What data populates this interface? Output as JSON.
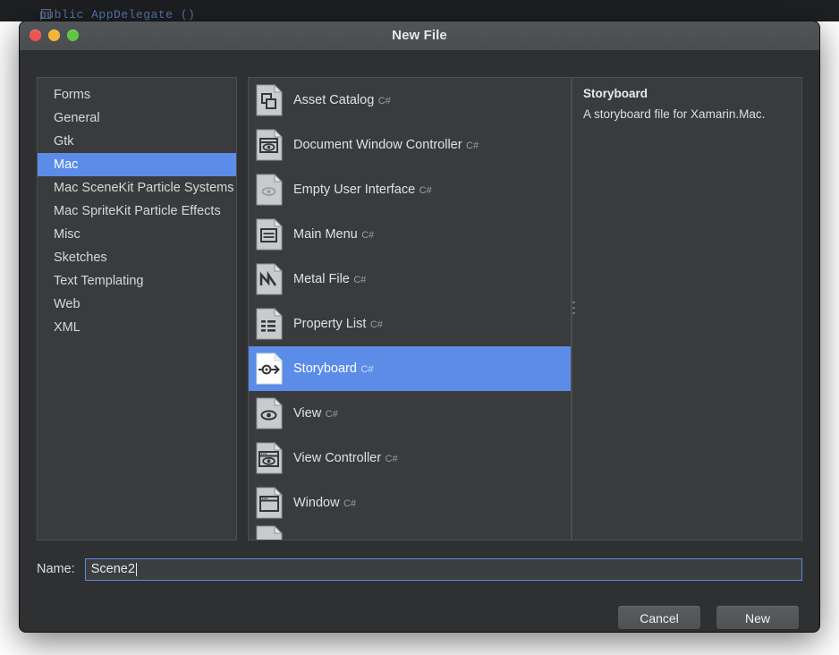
{
  "background": {
    "code_line": "public AppDelegate ()"
  },
  "window": {
    "title": "New File",
    "traffic_lights": [
      {
        "name": "close",
        "color": "#f0534d"
      },
      {
        "name": "minimize",
        "color": "#f2b435"
      },
      {
        "name": "maximize",
        "color": "#5bc83e"
      }
    ]
  },
  "colors": {
    "selection_blue": "#5b8ce8",
    "window_bg": "#2f3032",
    "pane_bg": "#3a3b3d",
    "titlebar_bg": "#4e5154"
  },
  "categories": {
    "selected": "Mac",
    "items": [
      {
        "label": "Forms"
      },
      {
        "label": "General"
      },
      {
        "label": "Gtk"
      },
      {
        "label": "Mac"
      },
      {
        "label": "Mac SceneKit Particle Systems"
      },
      {
        "label": "Mac SpriteKit Particle Effects"
      },
      {
        "label": "Misc"
      },
      {
        "label": "Sketches"
      },
      {
        "label": "Text Templating"
      },
      {
        "label": "Web"
      },
      {
        "label": "XML"
      }
    ]
  },
  "templates": {
    "selected": "Storyboard",
    "items": [
      {
        "name": "Asset Catalog",
        "lang": "C#",
        "icon": "asset-catalog-icon"
      },
      {
        "name": "Document Window Controller",
        "lang": "C#",
        "icon": "document-window-controller-icon"
      },
      {
        "name": "Empty User Interface",
        "lang": "C#",
        "icon": "empty-user-interface-icon"
      },
      {
        "name": "Main Menu",
        "lang": "C#",
        "icon": "main-menu-icon"
      },
      {
        "name": "Metal File",
        "lang": "C#",
        "icon": "metal-file-icon"
      },
      {
        "name": "Property List",
        "lang": "C#",
        "icon": "property-list-icon"
      },
      {
        "name": "Storyboard",
        "lang": "C#",
        "icon": "storyboard-icon"
      },
      {
        "name": "View",
        "lang": "C#",
        "icon": "view-icon"
      },
      {
        "name": "View Controller",
        "lang": "C#",
        "icon": "view-controller-icon"
      },
      {
        "name": "Window",
        "lang": "C#",
        "icon": "window-icon"
      }
    ]
  },
  "details": {
    "title": "Storyboard",
    "description": "A storyboard file for Xamarin.Mac."
  },
  "name_row": {
    "label": "Name:",
    "value": "Scene2",
    "placeholder": ""
  },
  "buttons": {
    "cancel": "Cancel",
    "new": "New"
  }
}
